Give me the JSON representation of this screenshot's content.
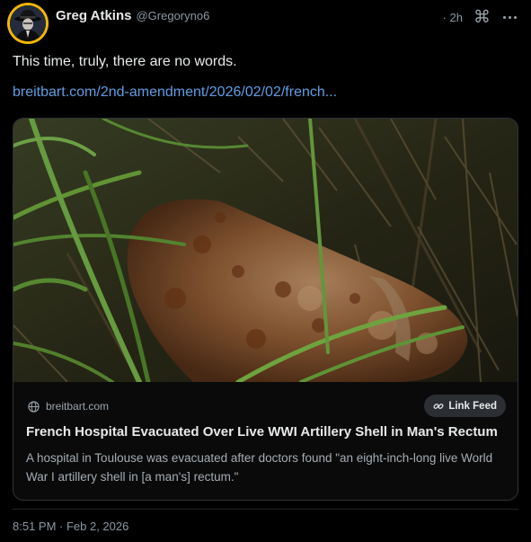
{
  "post": {
    "author": {
      "display_name": "Greg Atkins",
      "handle": "@Gregoryno6",
      "avatar_icon": "fedora-man-avatar"
    },
    "relative_time": "· 2h",
    "menu_icons": [
      "command-icon",
      "more-dots-icon"
    ],
    "text": "This time, truly, there are no words.",
    "link_text": "breitbart.com/2nd-amendment/2026/02/02/french...",
    "card": {
      "image_description_icon": "rusty-artillery-shell-photo",
      "source_domain": "breitbart.com",
      "link_feed_label": "Link Feed",
      "title": "French Hospital Evacuated Over Live WWI Artillery Shell in Man's Rectum",
      "description": "A hospital in Toulouse was evacuated after doctors found \"an eight-inch-long live World War I artillery shell in [a man's] rectum.\""
    },
    "timestamp": "8:51 PM · Feb 2, 2026"
  },
  "colors": {
    "background": "#000000",
    "text_primary": "#e7e9ea",
    "text_secondary": "#8b98a5",
    "link": "#5f9ee3",
    "avatar_ring": "#f2b705",
    "card_border": "#2f3336"
  }
}
